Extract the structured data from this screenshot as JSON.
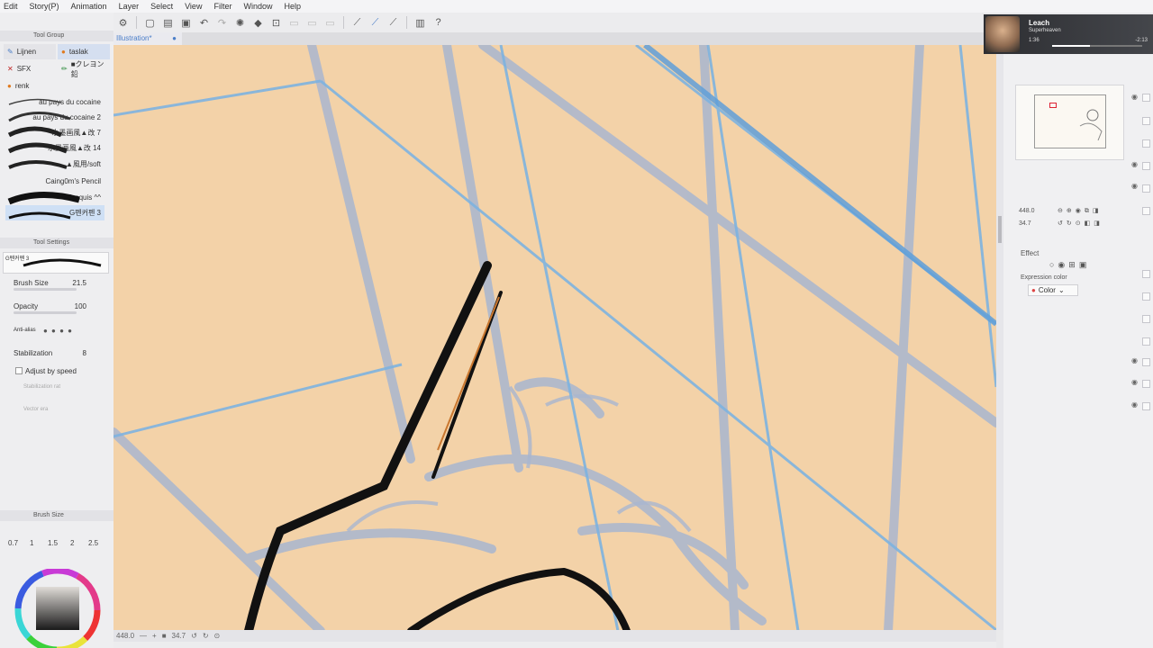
{
  "menu": [
    "Edit",
    "Story(P)",
    "Animation",
    "Layer",
    "Select",
    "View",
    "Filter",
    "Window",
    "Help"
  ],
  "canvas_tab": {
    "label": "Illustration*",
    "close": "●"
  },
  "tool_group": {
    "header": "Tool Group",
    "tabs": [
      {
        "label": "Lijnen",
        "icon": "brush-icon"
      },
      {
        "label": "taslak",
        "icon": "palette-icon"
      },
      {
        "label": "SFX",
        "icon": "sfx-icon"
      },
      {
        "label": "■クレヨン鉛",
        "icon": "crayon-icon"
      },
      {
        "label": "renk",
        "icon": "palette-icon"
      }
    ]
  },
  "brushes": [
    "au pays du cocaine",
    "au pays du cocaine 2",
    "水墨画風▲改 7",
    "水墨画風▲改 14",
    "▲風用/soft",
    "Caing0m's Pencil",
    "Croquis ^^",
    "G펜커펜 3"
  ],
  "tool_settings": {
    "header": "Tool Settings",
    "preset_name": "G펜커펜 3",
    "brush_size_label": "Brush Size",
    "brush_size_value": "21.5",
    "opacity_label": "Opacity",
    "opacity_value": "100",
    "anti_alias_label": "Anti-alias",
    "stabilization_label": "Stabilization",
    "stabilization_value": "8",
    "adjust_by_speed_label": "Adjust by speed",
    "stabilization_rate_label": "Stabilization rat",
    "vector_label": "Vector era"
  },
  "brush_size_panel": {
    "header": "Brush Size",
    "values": [
      "0.7",
      "1",
      "1.5",
      "2",
      "2.5"
    ]
  },
  "status_bar": {
    "zoom": "448.0",
    "angle": "34.7"
  },
  "media": {
    "title": "Leach",
    "artist": "Superheaven",
    "elapsed": "1:36",
    "remaining": "-2:13",
    "progress": 0.42
  },
  "navigator": {
    "zoom": "448.0",
    "angle": "34.7"
  },
  "effect_panel": {
    "effect_label": "Effect",
    "expression_color_label": "Expression color",
    "color_value": "Color"
  },
  "colors": {
    "canvas": "#f3d2a8",
    "accent": "#4a7ec8",
    "panel": "#eeeef0"
  }
}
